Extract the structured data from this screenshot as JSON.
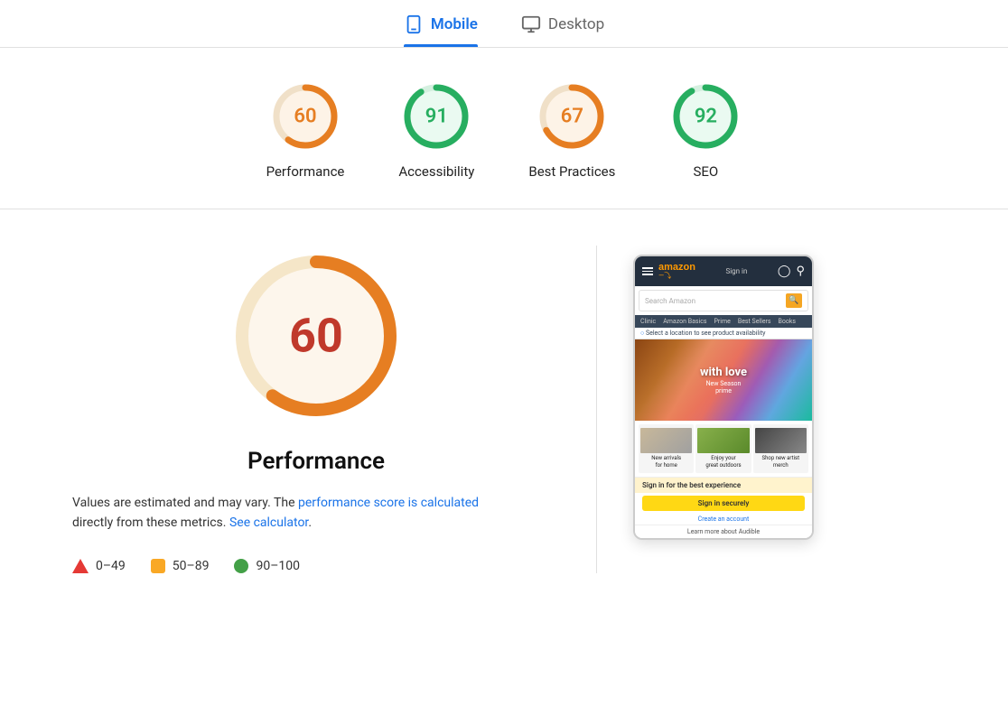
{
  "tabs": [
    {
      "id": "mobile",
      "label": "Mobile",
      "active": true
    },
    {
      "id": "desktop",
      "label": "Desktop",
      "active": false
    }
  ],
  "score_cards": [
    {
      "id": "performance",
      "value": 60,
      "label": "Performance",
      "color": "#e67e22",
      "bg": "#fdf3e7",
      "track": "#e67e22",
      "pct": 60
    },
    {
      "id": "accessibility",
      "value": 91,
      "label": "Accessibility",
      "color": "#27ae60",
      "bg": "#eafaf1",
      "track": "#27ae60",
      "pct": 91
    },
    {
      "id": "best-practices",
      "value": 67,
      "label": "Best Practices",
      "color": "#e67e22",
      "bg": "#fdf3e7",
      "track": "#e67e22",
      "pct": 67
    },
    {
      "id": "seo",
      "value": 92,
      "label": "SEO",
      "color": "#27ae60",
      "bg": "#eafaf1",
      "track": "#27ae60",
      "pct": 92
    }
  ],
  "main": {
    "big_score": {
      "value": "60",
      "label": "Performance",
      "color": "#c0392b",
      "gauge_color": "#e67e22",
      "bg": "#fdf3e7",
      "pct": 60
    },
    "description": "Values are estimated and may vary. The ",
    "link1": "performance score is calculated",
    "desc_mid": " directly from these metrics. ",
    "link2": "See calculator",
    "desc_end": ".",
    "legend": [
      {
        "type": "triangle",
        "color": "#e53935",
        "range": "0–49"
      },
      {
        "type": "square",
        "color": "#f9a825",
        "range": "50–89"
      },
      {
        "type": "circle",
        "color": "#43a047",
        "range": "90–100"
      }
    ]
  },
  "amazon": {
    "logo": "amazon",
    "sign_in": "Sign in",
    "search_placeholder": "Search Amazon",
    "nav_items": [
      "Clinic",
      "Amazon Basics",
      "Prime",
      "Best Sellers",
      "Books"
    ],
    "location_text": "Select a location to see product availability",
    "hero_text": "with love",
    "hero_sub": "New Season\nprime",
    "categories": [
      {
        "label": "New arrivals\nfor home"
      },
      {
        "label": "Enjoy your\ngreat outdoors"
      },
      {
        "label": "Shop new artist\nmerch"
      }
    ],
    "signin_prompt": "Sign in for the best experience",
    "signin_btn": "Sign in securely",
    "create_account": "Create an account",
    "audible": "Learn more about Audible"
  }
}
